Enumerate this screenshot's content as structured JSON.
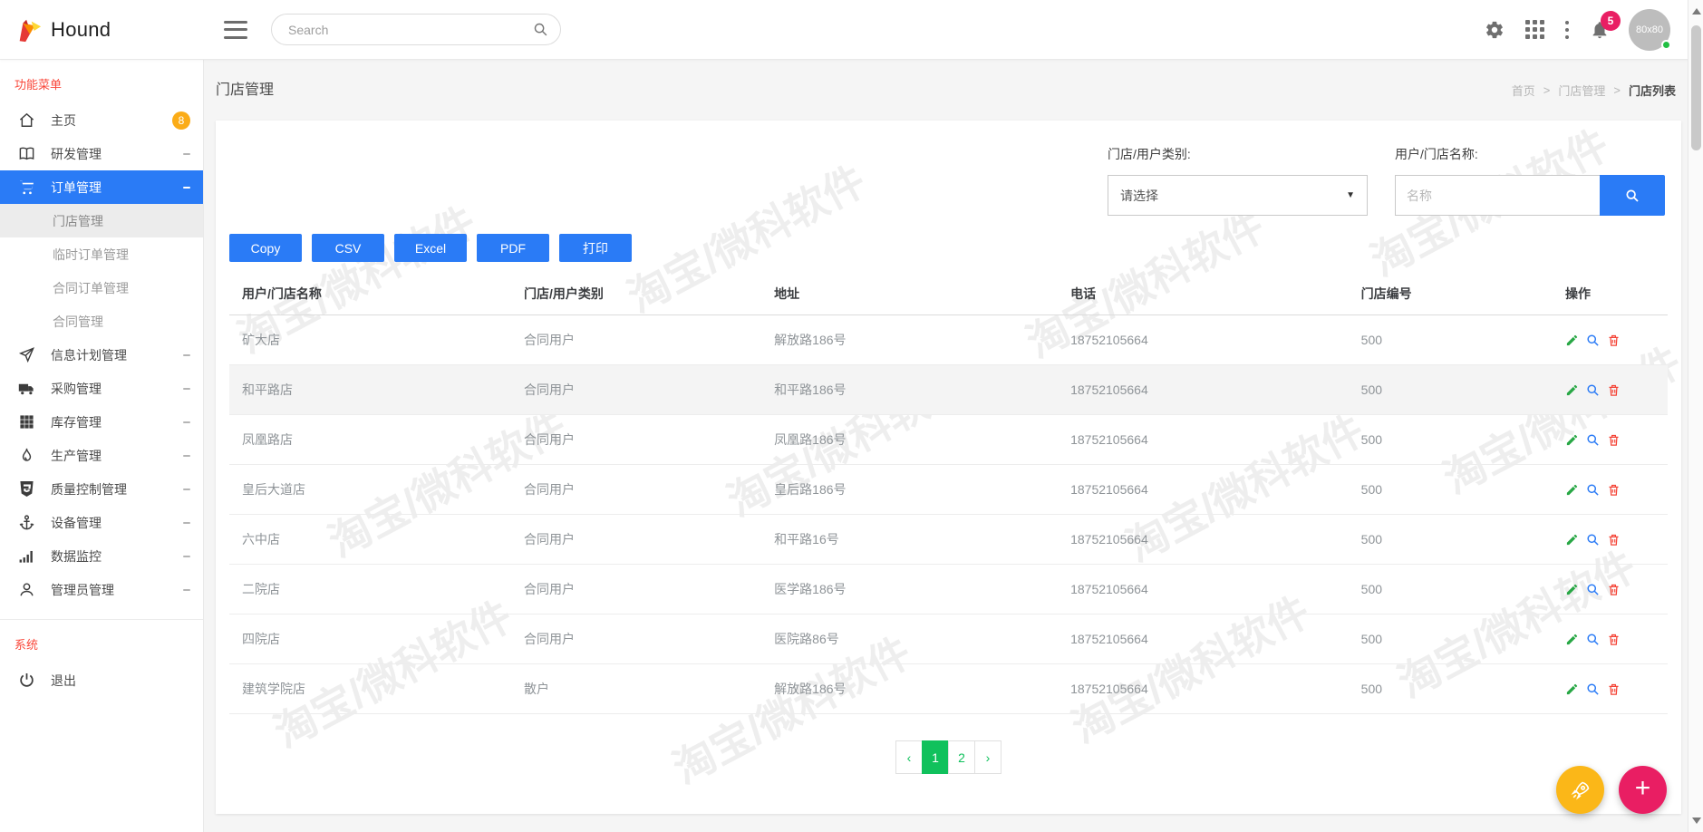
{
  "navbar": {
    "brand": "Hound",
    "search_placeholder": "Search",
    "notification_count": "5",
    "avatar_label": "80x80"
  },
  "sidebar": {
    "menu_label": "功能菜单",
    "system_label": "系统",
    "items": [
      {
        "label": "主页",
        "icon": "home-icon",
        "badge": "8"
      },
      {
        "label": "研发管理",
        "icon": "book-icon"
      },
      {
        "label": "订单管理",
        "icon": "cart-icon",
        "active": true
      },
      {
        "label": "门店管理",
        "sub": true,
        "active": true
      },
      {
        "label": "临时订单管理",
        "sub": true
      },
      {
        "label": "合同订单管理",
        "sub": true
      },
      {
        "label": "合同管理",
        "sub": true
      },
      {
        "label": "信息计划管理",
        "icon": "send-icon"
      },
      {
        "label": "采购管理",
        "icon": "truck-icon"
      },
      {
        "label": "库存管理",
        "icon": "grid-icon"
      },
      {
        "label": "生产管理",
        "icon": "flame-icon"
      },
      {
        "label": "质量控制管理",
        "icon": "shield-icon"
      },
      {
        "label": "设备管理",
        "icon": "anchor-icon"
      },
      {
        "label": "数据监控",
        "icon": "bars-icon"
      },
      {
        "label": "管理员管理",
        "icon": "user-icon"
      },
      {
        "label": "退出",
        "icon": "power-icon"
      }
    ]
  },
  "page": {
    "title": "门店管理",
    "breadcrumb_home": "首页",
    "breadcrumb_sep": ">",
    "breadcrumb_mid": "门店管理",
    "breadcrumb_current": "门店列表"
  },
  "filters": {
    "category_label": "门店/用户类别:",
    "category_value": "请选择",
    "category_caret": "▼",
    "name_label": "用户/门店名称:",
    "name_placeholder": "名称"
  },
  "toolbar": {
    "copy": "Copy",
    "csv": "CSV",
    "excel": "Excel",
    "pdf": "PDF",
    "print": "打印"
  },
  "table": {
    "columns": [
      "用户/门店名称",
      "门店/用户类别",
      "地址",
      "电话",
      "门店编号",
      "操作"
    ],
    "rows": [
      {
        "name": "矿大店",
        "category": "合同用户",
        "address": "解放路186号",
        "phone": "18752105664",
        "code": "500"
      },
      {
        "name": "和平路店",
        "category": "合同用户",
        "address": "和平路186号",
        "phone": "18752105664",
        "code": "500"
      },
      {
        "name": "凤凰路店",
        "category": "合同用户",
        "address": "凤凰路186号",
        "phone": "18752105664",
        "code": "500"
      },
      {
        "name": "皇后大道店",
        "category": "合同用户",
        "address": "皇后路186号",
        "phone": "18752105664",
        "code": "500"
      },
      {
        "name": "六中店",
        "category": "合同用户",
        "address": "和平路16号",
        "phone": "18752105664",
        "code": "500"
      },
      {
        "name": "二院店",
        "category": "合同用户",
        "address": "医学路186号",
        "phone": "18752105664",
        "code": "500"
      },
      {
        "name": "四院店",
        "category": "合同用户",
        "address": "医院路86号",
        "phone": "18752105664",
        "code": "500"
      },
      {
        "name": "建筑学院店",
        "category": "散户",
        "address": "解放路186号",
        "phone": "18752105664",
        "code": "500"
      }
    ]
  },
  "pagination": {
    "prev": "‹",
    "pages": [
      "1",
      "2"
    ],
    "active_page": "1",
    "next": "›"
  },
  "watermark": {
    "text": "淘宝/微科软件"
  },
  "fab": {
    "plus": "+"
  },
  "icons": {
    "navbar": [
      "gear-icon",
      "apps-grid-icon",
      "kebab-icon",
      "bell-icon"
    ],
    "row_actions": [
      "edit-pencil-icon",
      "view-magnifier-icon",
      "delete-trash-icon"
    ],
    "fabs": [
      "rocket-icon",
      "plus-icon"
    ]
  },
  "colors": {
    "accent_blue": "#2a7bf6",
    "accent_green": "#10c15c",
    "accent_pink": "#e91e63",
    "accent_amber": "#fbac17",
    "section_red": "#f9483b"
  }
}
